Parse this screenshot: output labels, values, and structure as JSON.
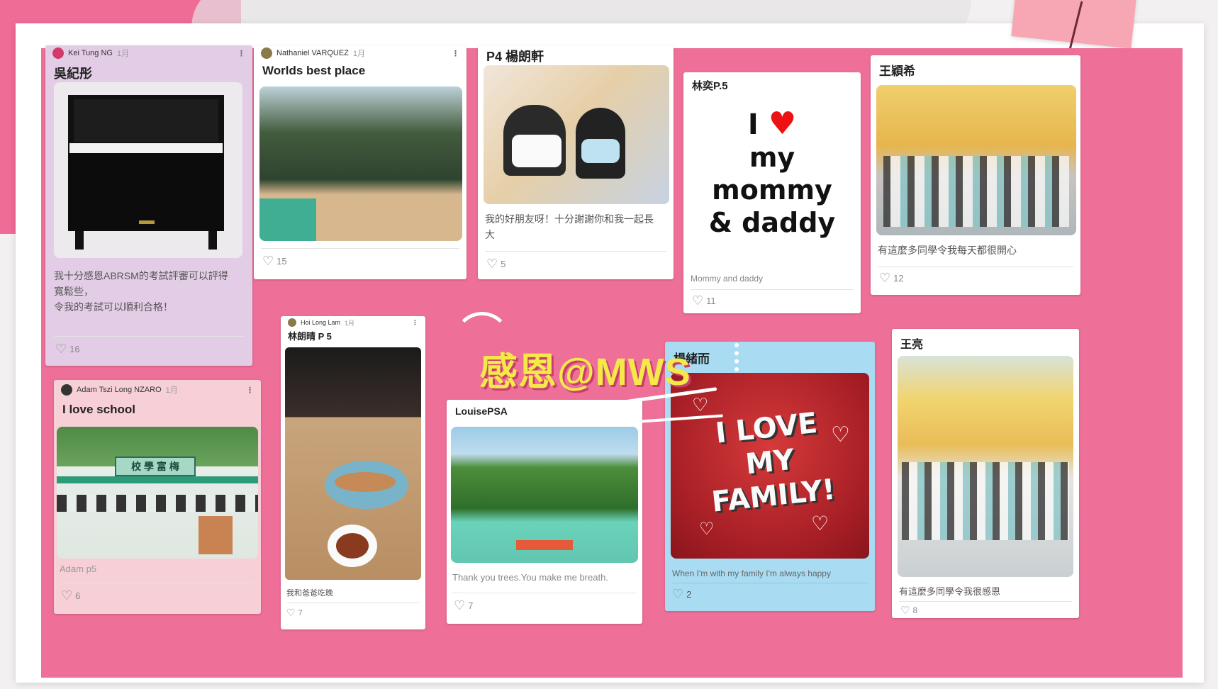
{
  "banner": {
    "text": "感恩@MWS"
  },
  "cards": {
    "piano": {
      "author": "Kei Tung NG",
      "ago": "1月",
      "title": "吳紀彤",
      "body_line1": "我十分感恩ABRSM的考試評審可以評得",
      "body_line2": "寬鬆些，",
      "body_line3": "令我的考試可以順利合格！",
      "likes": "16"
    },
    "worlds": {
      "author": "Nathaniel VARQUEZ",
      "ago": "1月",
      "title": "Worlds best place",
      "likes": "15"
    },
    "p4": {
      "title": "P4 楊朗軒",
      "body_line1": "我的好朋友呀！十分謝謝你和我一起長",
      "body_line2": "大",
      "likes": "5"
    },
    "mommy": {
      "title": "林奕P.5",
      "big_i": "I",
      "big_line1": "my",
      "big_line2": "mommy",
      "big_line3": "& daddy",
      "caption": "Mommy and daddy",
      "likes": "11"
    },
    "wangying": {
      "title": "王穎希",
      "body": "有這麼多同學令我每天都很開心",
      "likes": "12"
    },
    "adam": {
      "author": "Adam Tszi Long NZARO",
      "ago": "1月",
      "title": "I love school",
      "sign_text": "校 學 富 梅",
      "caption": "Adam p5",
      "likes": "6"
    },
    "lunch": {
      "author": "Hoi Long Lam",
      "ago": "1月",
      "title": "林朗晴 P 5",
      "caption": "我和爸爸吃晚",
      "likes": "7"
    },
    "louise": {
      "title": "LouisePSA",
      "caption": "Thank you trees.You make me breath.",
      "likes": "7"
    },
    "family": {
      "title": "楊緒而",
      "poster_line1": "I LOVE",
      "poster_line2": "MY",
      "poster_line3": "FAMILY!",
      "caption": "When I'm with my family I'm always happy",
      "likes": "2"
    },
    "wangliang": {
      "title": "王亮",
      "body": "有這麼多同學令我很感恩",
      "likes": "8"
    }
  },
  "colors": {
    "board": "#ee6f97",
    "banner": "#f5e94a",
    "purple_card": "#e3cde6",
    "sky_card": "#a9dcf2",
    "rose_card": "#f7cfd6"
  }
}
